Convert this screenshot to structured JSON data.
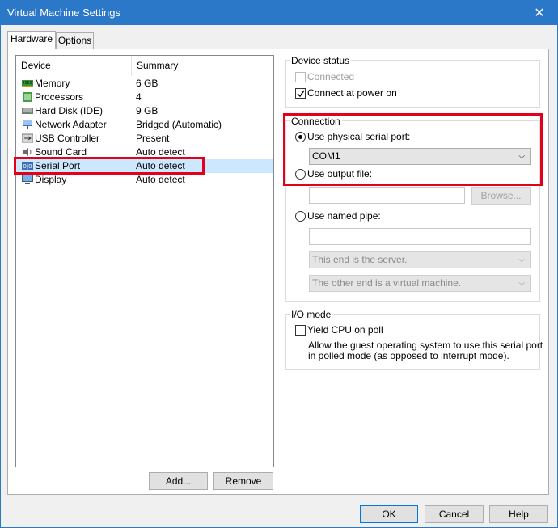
{
  "window": {
    "title": "Virtual Machine Settings",
    "close_glyph": "✕"
  },
  "tabs": [
    {
      "label": "Hardware"
    },
    {
      "label": "Options"
    }
  ],
  "device_list": {
    "columns": {
      "device": "Device",
      "summary": "Summary"
    },
    "rows": [
      {
        "device": "Memory",
        "summary": "6 GB",
        "icon": "memory-icon"
      },
      {
        "device": "Processors",
        "summary": "4",
        "icon": "processor-icon"
      },
      {
        "device": "Hard Disk (IDE)",
        "summary": "9 GB",
        "icon": "hard-disk-icon"
      },
      {
        "device": "Network Adapter",
        "summary": "Bridged (Automatic)",
        "icon": "network-adapter-icon"
      },
      {
        "device": "USB Controller",
        "summary": "Present",
        "icon": "usb-icon"
      },
      {
        "device": "Sound Card",
        "summary": "Auto detect",
        "icon": "sound-card-icon"
      },
      {
        "device": "Serial Port",
        "summary": "Auto detect",
        "icon": "serial-port-icon",
        "selected": true
      },
      {
        "device": "Display",
        "summary": "Auto detect",
        "icon": "display-icon"
      }
    ]
  },
  "list_buttons": {
    "add": "Add...",
    "remove": "Remove"
  },
  "device_status": {
    "title": "Device status",
    "connected": {
      "label": "Connected",
      "checked": false,
      "enabled": false
    },
    "connect_at_power_on": {
      "label": "Connect at power on",
      "checked": true
    }
  },
  "connection": {
    "title": "Connection",
    "use_physical": {
      "label": "Use physical serial port:",
      "selected": true
    },
    "physical_port_value": "COM1",
    "use_output_file": {
      "label": "Use output file:",
      "selected": false
    },
    "output_file_value": "",
    "browse_label": "Browse...",
    "use_named_pipe": {
      "label": "Use named pipe:",
      "selected": false
    },
    "named_pipe_value": "",
    "pipe_end_value": "This end is the server.",
    "pipe_other_value": "The other end is a virtual machine."
  },
  "io_mode": {
    "title": "I/O mode",
    "yield_cpu": {
      "label": "Yield CPU on poll",
      "checked": false
    },
    "description_line1": "Allow the guest operating system to use this serial port",
    "description_line2": "in polled mode (as opposed to interrupt mode)."
  },
  "dialog_buttons": {
    "ok": "OK",
    "cancel": "Cancel",
    "help": "Help"
  },
  "colors": {
    "title_bar": "#2b78c8",
    "highlight": "#e3001b",
    "selection": "#cce8ff"
  }
}
